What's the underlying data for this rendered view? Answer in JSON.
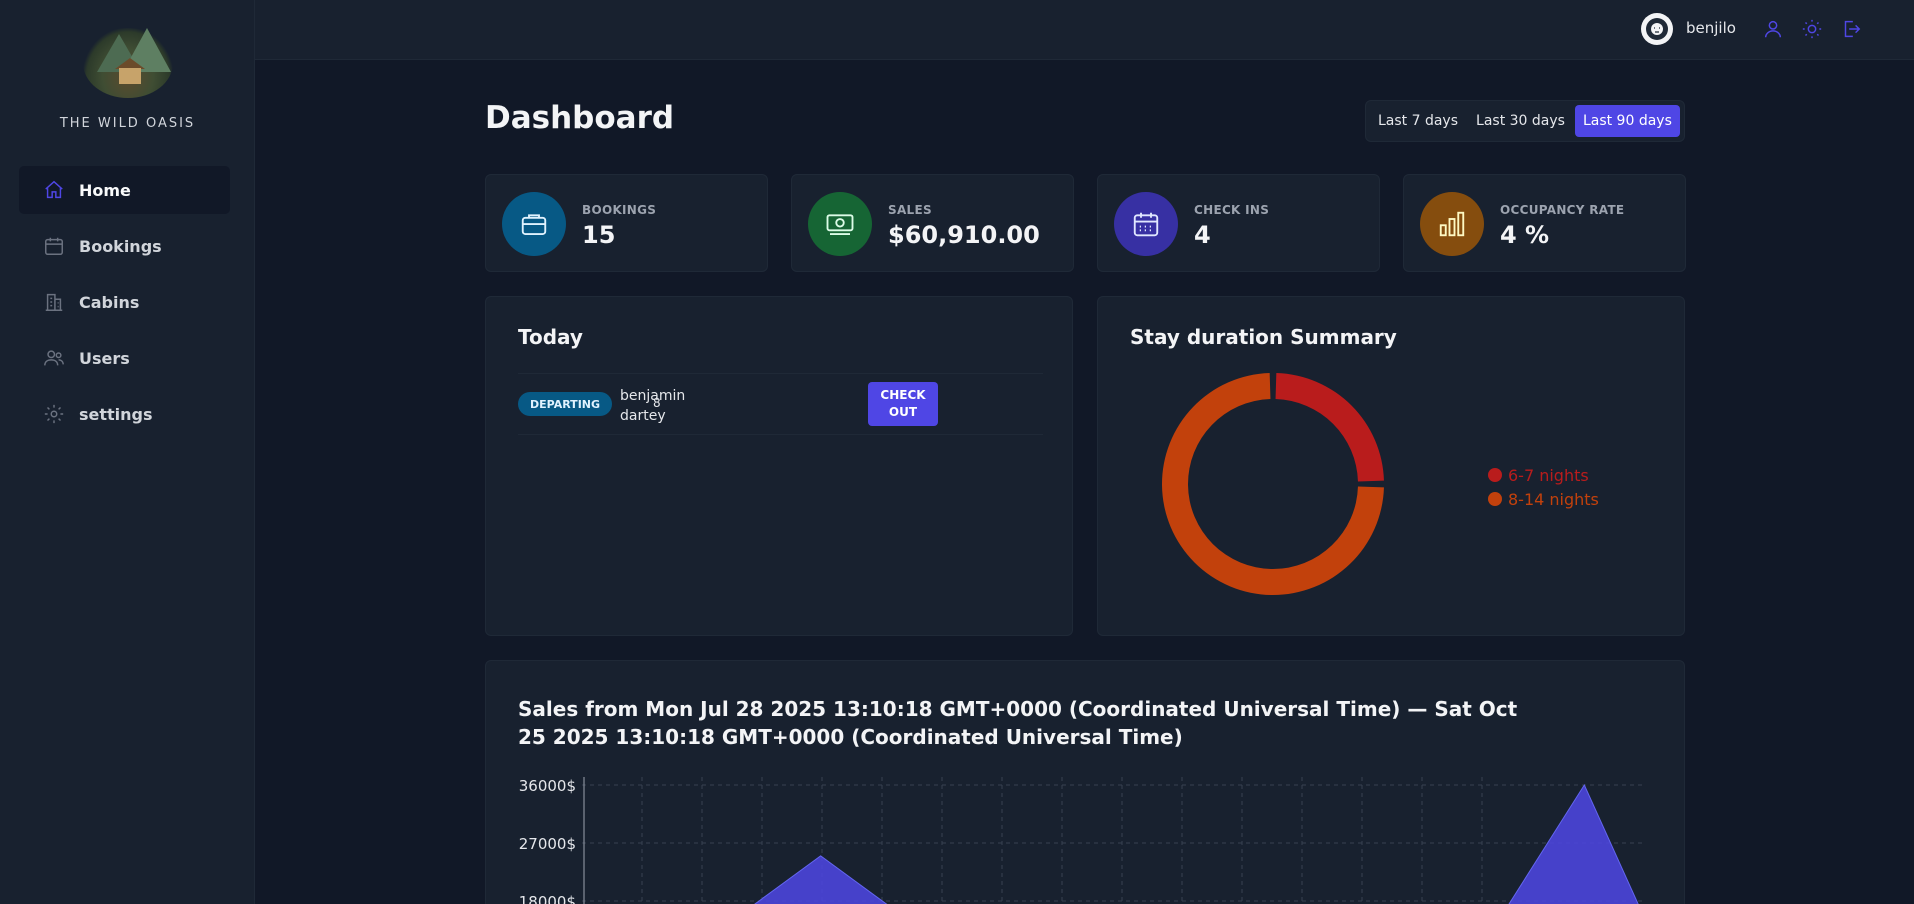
{
  "brand": {
    "name": "THE WILD OASIS"
  },
  "sidebar": {
    "items": [
      {
        "label": "Home",
        "icon": "home-icon",
        "active": true
      },
      {
        "label": "Bookings",
        "icon": "calendar-icon",
        "active": false
      },
      {
        "label": "Cabins",
        "icon": "building-icon",
        "active": false
      },
      {
        "label": "Users",
        "icon": "users-icon",
        "active": false
      },
      {
        "label": "settings",
        "icon": "gear-icon",
        "active": false
      }
    ]
  },
  "header": {
    "username": "benjilo",
    "icons": [
      "user-icon",
      "sun-icon",
      "logout-icon"
    ]
  },
  "main": {
    "title": "Dashboard",
    "filters": [
      {
        "label": "Last 7 days",
        "active": false
      },
      {
        "label": "Last 30 days",
        "active": false
      },
      {
        "label": "Last 90 days",
        "active": true
      }
    ],
    "stats": [
      {
        "label": "BOOKINGS",
        "value": "15",
        "icon": "briefcase-icon",
        "color": "#075985"
      },
      {
        "label": "SALES",
        "value": "$60,910.00",
        "icon": "banknotes-icon",
        "color": "#166534"
      },
      {
        "label": "CHECK INS",
        "value": "4",
        "icon": "calendar-days-icon",
        "color": "#3730a3"
      },
      {
        "label": "OCCUPANCY RATE",
        "value": "4 %",
        "icon": "chart-bar-icon",
        "color": "#854d0e"
      }
    ],
    "today": {
      "title": "Today",
      "activities": [
        {
          "status": "DEPARTING",
          "guest": "benjamin dartey",
          "nights": "8",
          "action": "CHECK OUT"
        }
      ]
    },
    "duration": {
      "title": "Stay duration Summary",
      "legend": [
        {
          "label": "6-7 nights",
          "color": "#b91c1c"
        },
        {
          "label": "8-14 nights",
          "color": "#c2410c"
        }
      ]
    },
    "sales": {
      "title": "Sales from Mon Jul 28 2025 13:10:18 GMT+0000 (Coordinated Universal Time) — Sat Oct 25 2025 13:10:18 GMT+0000 (Coordinated Universal Time)",
      "yticks": [
        "36000$",
        "27000$",
        "18000$"
      ]
    }
  },
  "chart_data": [
    {
      "type": "pie",
      "title": "Stay duration Summary",
      "categories": [
        "6-7 nights",
        "8-14 nights"
      ],
      "values": [
        25,
        75
      ],
      "colors": [
        "#b91c1c",
        "#c2410c"
      ],
      "legend": "right"
    },
    {
      "type": "area",
      "title": "Sales from Mon Jul 28 2025 13:10:18 GMT+0000 (Coordinated Universal Time) — Sat Oct 25 2025 13:10:18 GMT+0000 (Coordinated Universal Time)",
      "ylim": [
        0,
        36000
      ],
      "yticks": [
        36000,
        27000,
        18000
      ],
      "grid": true,
      "series": [
        {
          "points": [
            {
              "x": "2025-08-10",
              "y": 0
            },
            {
              "x": "2025-08-17",
              "y": 25000
            },
            {
              "x": "2025-08-24",
              "y": 0
            },
            {
              "x": "2025-10-13",
              "y": 0
            },
            {
              "x": "2025-10-20",
              "y": 36000
            },
            {
              "x": "2025-10-25",
              "y": 0
            }
          ]
        }
      ]
    }
  ]
}
